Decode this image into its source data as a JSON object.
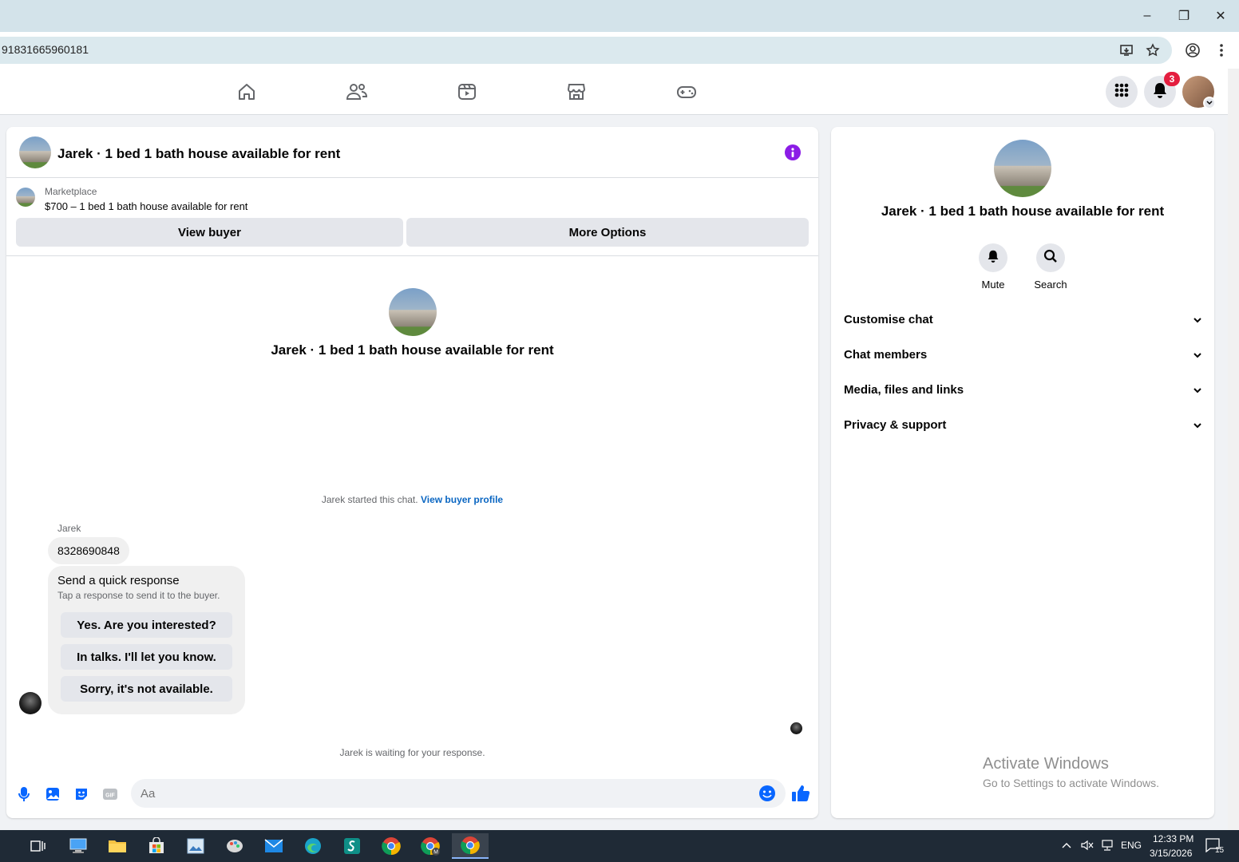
{
  "browser": {
    "url": "91831665960181",
    "window_controls": {
      "minimize": "–",
      "restore": "❐",
      "close": "✕"
    }
  },
  "fb_nav": {
    "icons": [
      "home-icon",
      "friends-icon",
      "watch-icon",
      "marketplace-icon",
      "gaming-icon"
    ],
    "notification_count": "3"
  },
  "chat": {
    "header_title": "Jarek · 1 bed 1 bath house available for rent",
    "marketplace_label": "Marketplace",
    "listing": "$700 – 1 bed 1 bath house available for rent",
    "view_buyer": "View buyer",
    "more_options": "More Options",
    "center_title": "Jarek · 1 bed 1 bath house available for rent",
    "started_text": "Jarek started this chat.",
    "view_buyer_profile": "View buyer profile",
    "sender_name": "Jarek",
    "message": "8328690848",
    "quick_response": {
      "title": "Send a quick response",
      "subtitle": "Tap a response to send it to the buyer.",
      "options": [
        "Yes. Are you interested?",
        "In talks. I'll let you know.",
        "Sorry, it's not available."
      ]
    },
    "waiting_text": "Jarek is waiting for your response.",
    "composer_placeholder": "Aa"
  },
  "details": {
    "title": "Jarek · 1 bed 1 bath house available for rent",
    "mute_label": "Mute",
    "search_label": "Search",
    "sections": [
      "Customise chat",
      "Chat members",
      "Media, files and links",
      "Privacy & support"
    ]
  },
  "watermark": {
    "line1": "Activate Windows",
    "line2": "Go to Settings to activate Windows."
  },
  "taskbar": {
    "language": "ENG",
    "time": "12:33 PM",
    "date": "3/15/2026",
    "notification_count": "15"
  },
  "colors": {
    "accent": "#0866ff",
    "info": "#8b1ce6",
    "badge": "#e41e3f"
  }
}
